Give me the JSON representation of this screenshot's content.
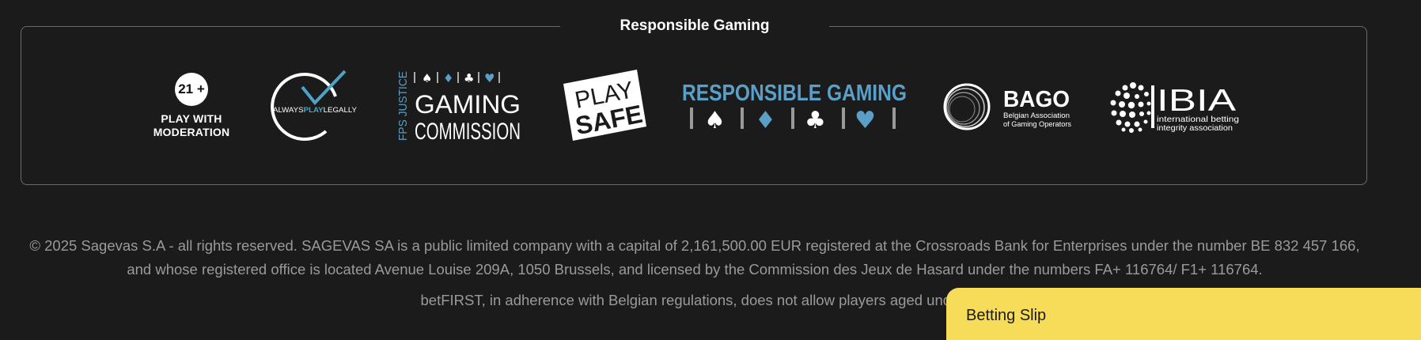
{
  "responsible_gaming": {
    "title": "Responsible Gaming",
    "logos": {
      "age": {
        "badge": "21 +",
        "line1": "PLAY WITH",
        "line2": "MODERATION"
      },
      "always_play_legally": {
        "prefix": "ALWAYS",
        "highlight": "PLAY",
        "suffix": "LEGALLY"
      },
      "gaming_commission": {
        "side": "FPS JUSTICE",
        "line1": "GAMING",
        "line2": "COMMISSION"
      },
      "play_safe": {
        "line1": "PLAY",
        "line2": "SAFE"
      },
      "responsible_gaming_logo": {
        "text": "RESPONSIBLE GAMING"
      },
      "bago": {
        "name": "BAGO",
        "line1": "Belgian Association",
        "line2": "of Gaming Operators"
      },
      "ibia": {
        "name": "IBIA",
        "line1": "international betting",
        "line2": "integrity association"
      }
    }
  },
  "footer": {
    "legal_text": "© 2025 Sagevas S.A - all rights reserved. SAGEVAS SA is a public limited company with a capital of 2,161,500.00 EUR registered at the Crossroads Bank for Enterprises under the number BE 832 457 166, and whose registered office is located Avenue Louise 209A, 1050 Brussels, and licensed by the Commission des Jeux de Hasard under the numbers FA+ 116764/ F1+ 116764.",
    "age_notice": "betFIRST, in adherence with Belgian regulations, does not allow players aged under"
  },
  "betting_slip": {
    "label": "Betting Slip"
  },
  "colors": {
    "background": "#1b1b1b",
    "slip_yellow": "#f6dc58",
    "accent_blue": "#5a9fc7",
    "check_blue": "#4fa3c7",
    "muted_text": "#9a9a9a"
  }
}
